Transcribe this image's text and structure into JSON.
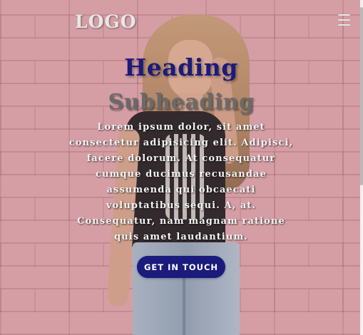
{
  "nav": {
    "logo": "LOGO",
    "menu_icon": "hamburger-menu-icon"
  },
  "hero": {
    "heading": "Heading",
    "subheading": "Subheading",
    "body": "Lorem ipsum dolor, sit amet consectetur adipisicing elit. Adipisci, facere dolorum. At consequatur cumque ducimus recusandae assumenda qui obcaecati voluptatibus sequi. A, at. Consequatur, nam magnam ratione quis amet laudantium.",
    "cta_label": "GET IN TOUCH"
  },
  "colors": {
    "accent": "#1b1a7d",
    "background": "#e1a9b0",
    "subheading": "#6a6a6a"
  }
}
